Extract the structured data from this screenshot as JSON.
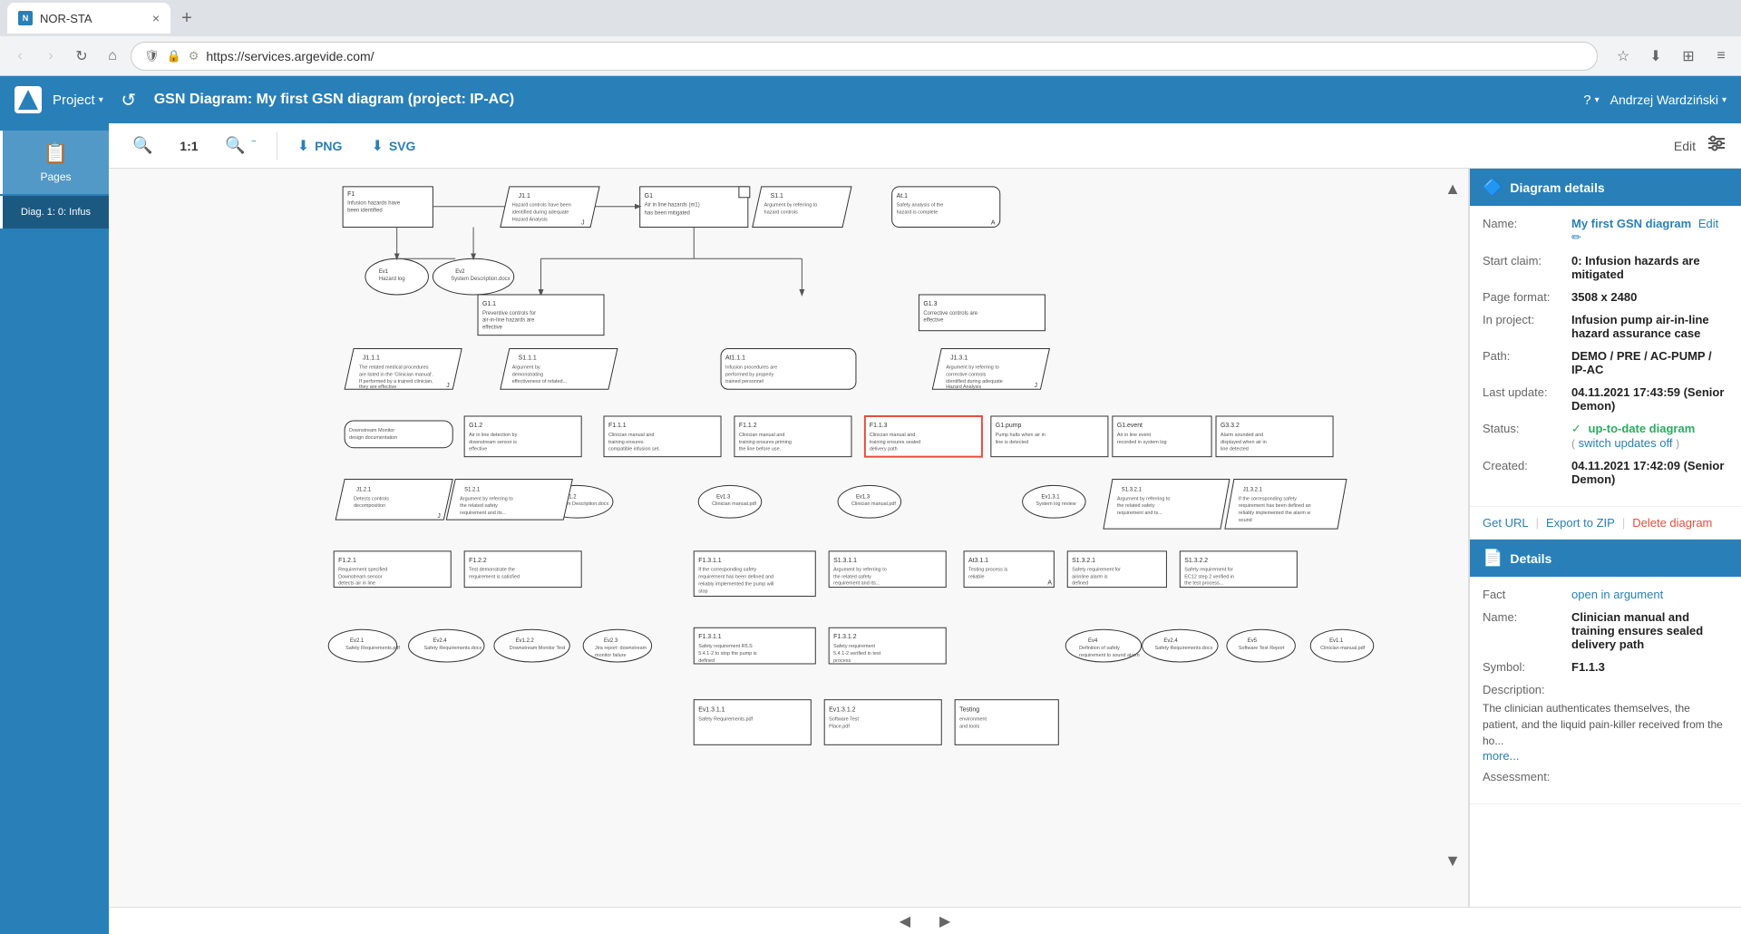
{
  "browser": {
    "tab_title": "NOR-STA",
    "tab_close": "×",
    "tab_new": "+",
    "nav_back": "‹",
    "nav_forward": "›",
    "nav_refresh": "↻",
    "nav_home": "⌂",
    "address": "https://services.argevide.com/",
    "bookmark_icon": "☆",
    "download_icon": "⬇",
    "extensions_icon": "⊞",
    "menu_icon": "≡"
  },
  "app_header": {
    "project_label": "Project",
    "project_caret": "▾",
    "diagram_title": "GSN Diagram: My first GSN diagram (project: IP-AC)",
    "help_label": "?",
    "help_caret": "▾",
    "user_label": "Andrzej Wardziński",
    "user_caret": "▾"
  },
  "sidebar": {
    "items": [
      {
        "label": "Pages",
        "icon": "📋",
        "active": true
      },
      {
        "label": "Diag. 1: 0: Infus",
        "icon": "",
        "active": true
      }
    ]
  },
  "toolbar": {
    "zoom_in": "+",
    "zoom_level": "1:1",
    "zoom_out": "−",
    "png_label": "PNG",
    "svg_label": "SVG",
    "edit_label": "Edit",
    "filter_icon": "⚙"
  },
  "diagram_details": {
    "section_title": "Diagram details",
    "section_icon": "🔷",
    "name_label": "Name:",
    "name_value": "My first GSN diagram",
    "name_edit": "Edit ✏",
    "start_claim_label": "Start claim:",
    "start_claim_value": "0: Infusion hazards are mitigated",
    "page_format_label": "Page format:",
    "page_format_value": "3508 x 2480",
    "in_project_label": "In project:",
    "in_project_value": "Infusion pump air-in-line hazard assurance case",
    "path_label": "Path:",
    "path_value": "DEMO / PRE / AC-PUMP / IP-AC",
    "last_update_label": "Last update:",
    "last_update_value": "04.11.2021 17:43:59 (Senior Demon)",
    "status_label": "Status:",
    "status_value": "up-to-date diagram",
    "status_switch": "switch updates off",
    "status_check": "✓",
    "created_label": "Created:",
    "created_value": "04.11.2021 17:42:09 (Senior Demon)",
    "get_url": "Get URL",
    "export_zip": "Export to ZIP",
    "delete_diagram": "Delete diagram",
    "separator1": "|",
    "separator2": "|"
  },
  "details_section": {
    "section_title": "Details",
    "section_icon": "📄",
    "fact_label": "Fact",
    "fact_link": "open in argument",
    "name_label": "Name:",
    "name_value": "Clinician manual and training ensures sealed delivery path",
    "symbol_label": "Symbol:",
    "symbol_value": "F1.1.3",
    "description_label": "Description:",
    "description_value": "The clinician authenticates themselves, the patient, and the liquid pain-killer received from the ho...",
    "more_link": "more...",
    "assessment_label": "Assessment:"
  },
  "page_nav": {
    "prev": "◀",
    "next": "▶"
  }
}
